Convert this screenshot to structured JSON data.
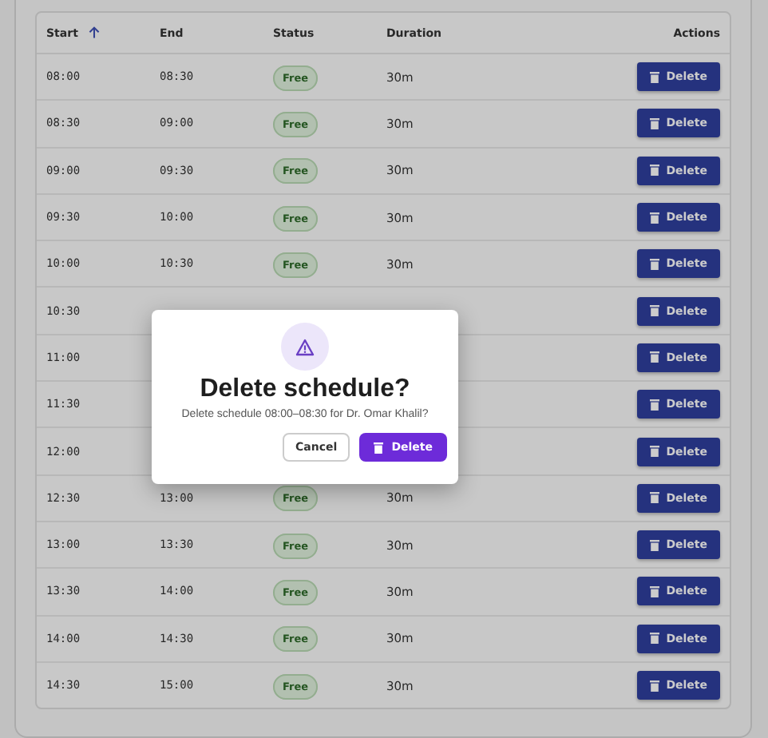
{
  "table": {
    "columns": [
      {
        "label": "Start",
        "sorted": true
      },
      {
        "label": "End"
      },
      {
        "label": "Status"
      },
      {
        "label": "Duration"
      },
      {
        "label": "Actions"
      }
    ],
    "rows": [
      {
        "start": "08:00",
        "end": "08:30",
        "status": "Free",
        "duration": "30m",
        "action": "Delete"
      },
      {
        "start": "08:30",
        "end": "09:00",
        "status": "Free",
        "duration": "30m",
        "action": "Delete"
      },
      {
        "start": "09:00",
        "end": "09:30",
        "status": "Free",
        "duration": "30m",
        "action": "Delete"
      },
      {
        "start": "09:30",
        "end": "10:00",
        "status": "Free",
        "duration": "30m",
        "action": "Delete"
      },
      {
        "start": "10:00",
        "end": "10:30",
        "status": "Free",
        "duration": "30m",
        "action": "Delete"
      },
      {
        "start": "10:30",
        "action": "Delete"
      },
      {
        "start": "11:00",
        "action": "Delete"
      },
      {
        "start": "11:30",
        "action": "Delete"
      },
      {
        "start": "12:00",
        "action": "Delete"
      },
      {
        "start": "12:30",
        "end": "13:00",
        "status": "Free",
        "duration": "30m",
        "action": "Delete"
      },
      {
        "start": "13:00",
        "end": "13:30",
        "status": "Free",
        "duration": "30m",
        "action": "Delete"
      },
      {
        "start": "13:30",
        "end": "14:00",
        "status": "Free",
        "duration": "30m",
        "action": "Delete"
      },
      {
        "start": "14:00",
        "end": "14:30",
        "status": "Free",
        "duration": "30m",
        "action": "Delete"
      },
      {
        "start": "14:30",
        "end": "15:00",
        "status": "Free",
        "duration": "30m",
        "action": "Delete"
      }
    ]
  },
  "dialog": {
    "title": "Delete schedule?",
    "message": "Delete schedule 08:00–08:30 for Dr. Omar Khalil?",
    "buttons": [
      {
        "label": "Cancel",
        "kind": "secondary"
      },
      {
        "label": "Delete",
        "kind": "danger"
      }
    ]
  }
}
